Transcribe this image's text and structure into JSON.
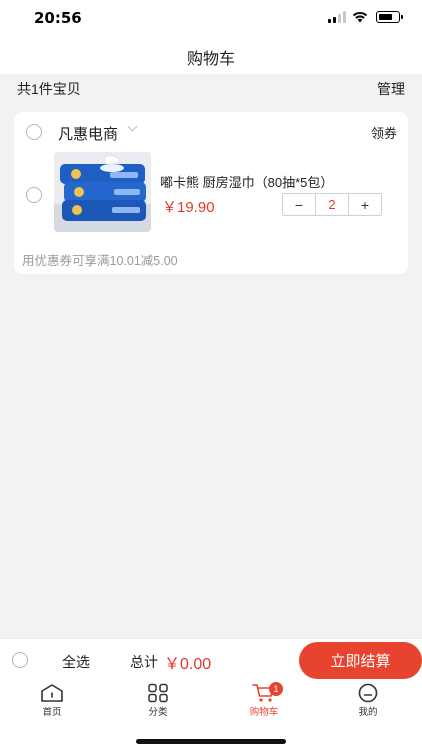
{
  "status_bar": {
    "time": "20:56"
  },
  "nav": {
    "title": "购物车"
  },
  "summary": {
    "count_text": "共1件宝贝",
    "manage_label": "管理"
  },
  "shop": {
    "name": "凡惠电商",
    "coupon_label": "领券",
    "items": [
      {
        "title": "嘟卡熊 厨房湿巾（80抽*5包）",
        "price": "￥19.90",
        "quantity": "2",
        "decrement": "−",
        "increment": "+",
        "image_icon": "wet-wipes-product-image"
      }
    ],
    "coupon_hint": "用优惠券可享满10.01减5.00"
  },
  "checkout": {
    "select_all_label": "全选",
    "total_label": "总计",
    "total_amount": "￥0.00",
    "submit_label": "立即结算"
  },
  "tabs": [
    {
      "label": "首页",
      "icon": "home-icon"
    },
    {
      "label": "分类",
      "icon": "category-grid-icon"
    },
    {
      "label": "购物车",
      "icon": "cart-icon",
      "badge": "1",
      "active": true
    },
    {
      "label": "我的",
      "icon": "profile-icon"
    }
  ],
  "colors": {
    "accent": "#e8432f",
    "price": "#e23a2a",
    "background": "#f2f2f2"
  }
}
